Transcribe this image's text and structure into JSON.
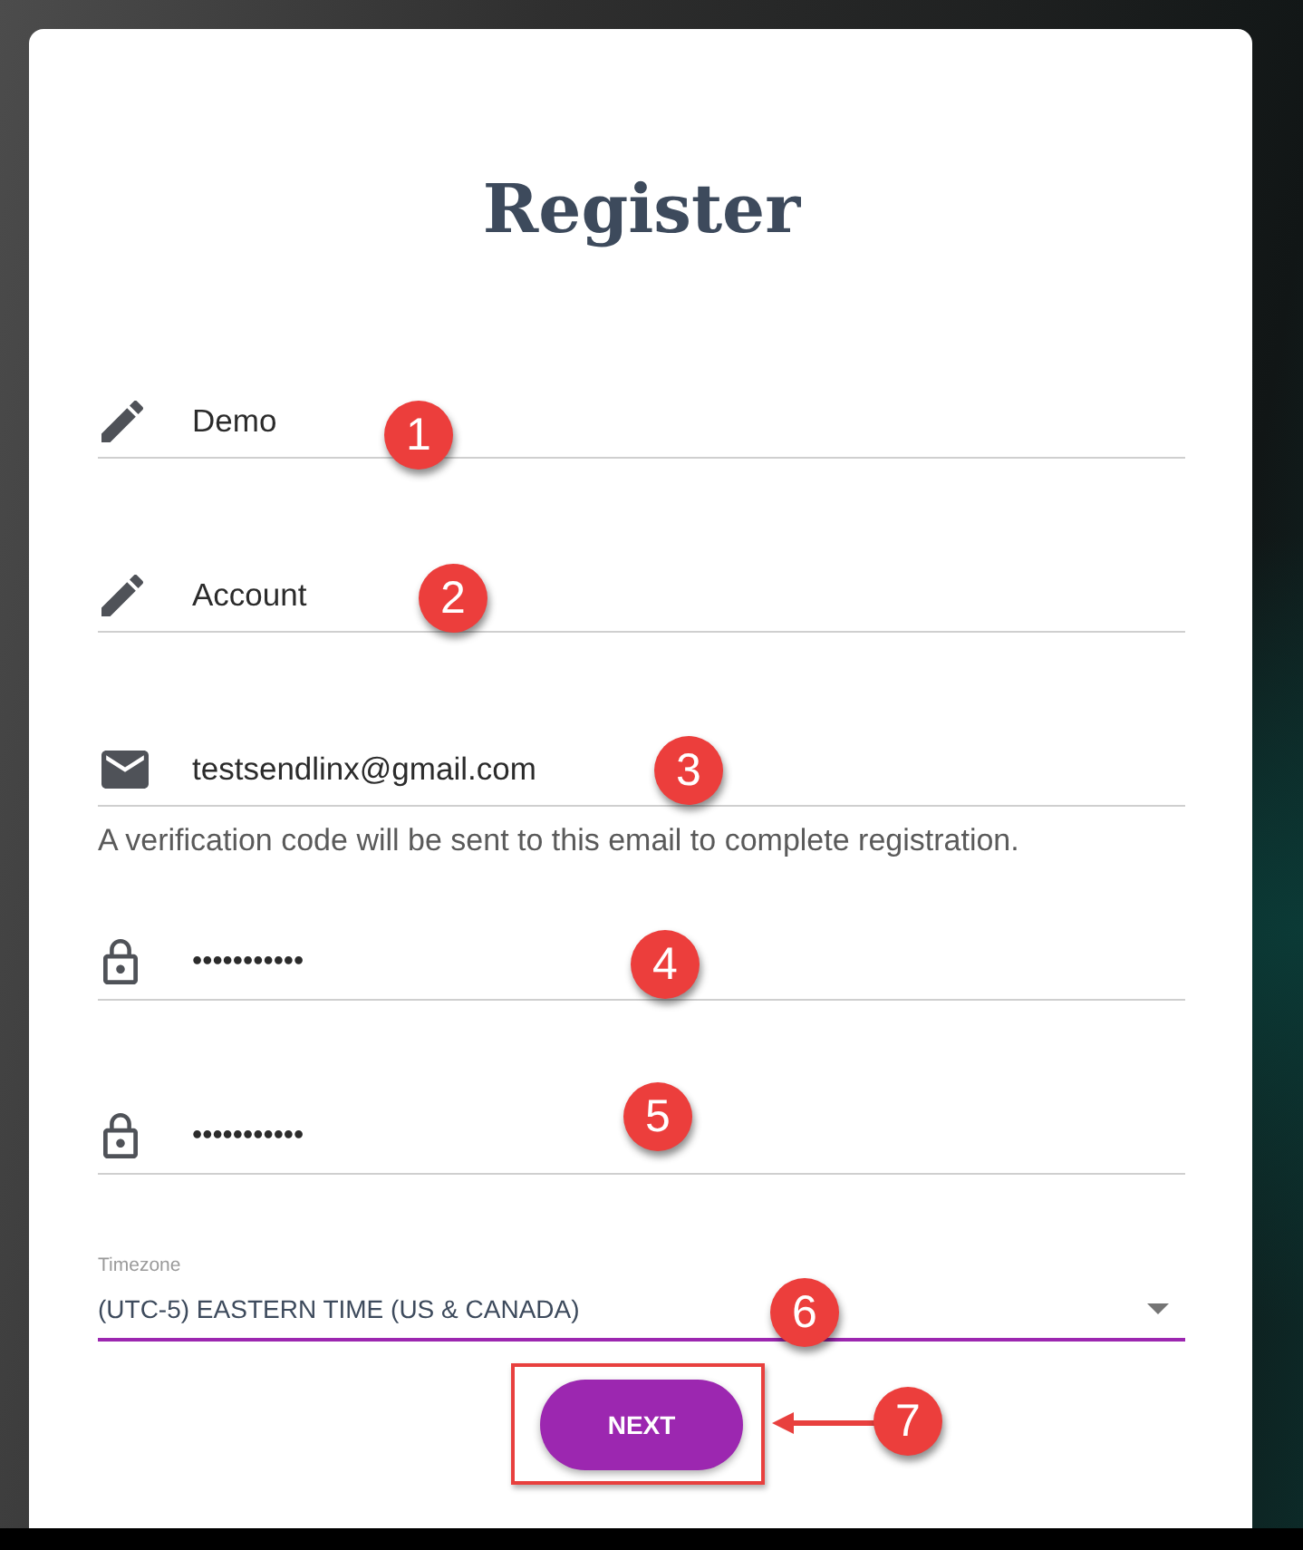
{
  "title": "Register",
  "fields": [
    {
      "kind": "name",
      "value": "Demo",
      "callout": "1"
    },
    {
      "kind": "name",
      "value": "Account",
      "callout": "2"
    },
    {
      "kind": "email",
      "value": "testsendlinx@gmail.com",
      "callout": "3",
      "helper": "A verification code will be sent to this email to complete registration."
    },
    {
      "kind": "password",
      "value": "•••••••••••",
      "callout": "4"
    },
    {
      "kind": "password",
      "value": "•••••••••••",
      "callout": "5"
    }
  ],
  "timezone": {
    "label": "Timezone",
    "value": "(UTC-5) EASTERN TIME (US & CANADA)",
    "focused": true,
    "callout": "6"
  },
  "next_button": {
    "label": "NEXT",
    "highlighted": true,
    "callout": "7"
  }
}
